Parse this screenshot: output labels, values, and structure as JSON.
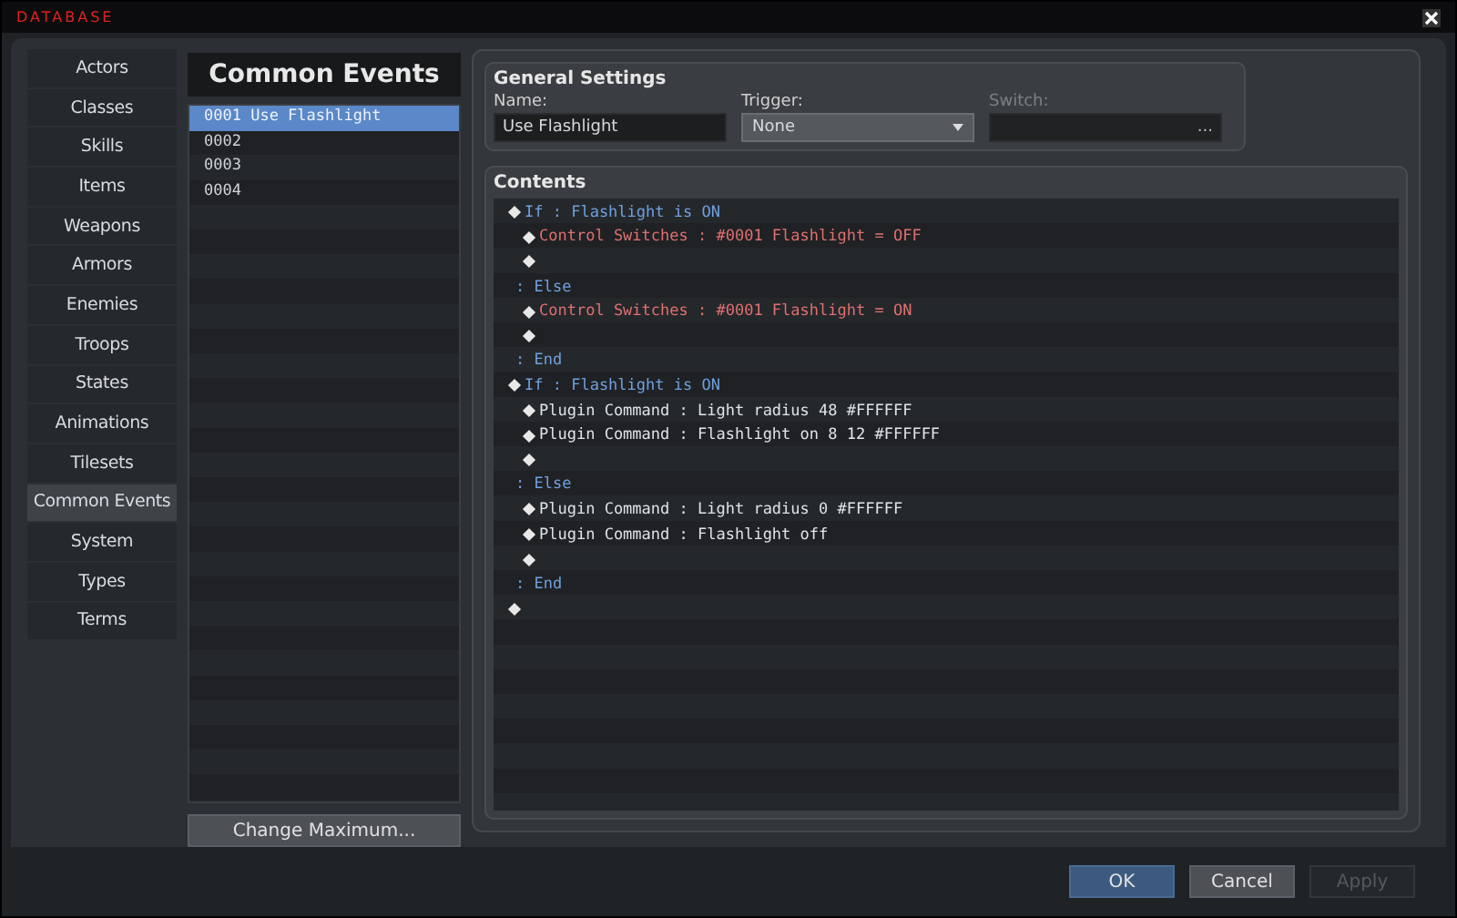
{
  "window": {
    "title": "DATABASE"
  },
  "sidebar": {
    "items": [
      {
        "label": "Actors",
        "selected": false
      },
      {
        "label": "Classes",
        "selected": false
      },
      {
        "label": "Skills",
        "selected": false
      },
      {
        "label": "Items",
        "selected": false
      },
      {
        "label": "Weapons",
        "selected": false
      },
      {
        "label": "Armors",
        "selected": false
      },
      {
        "label": "Enemies",
        "selected": false
      },
      {
        "label": "Troops",
        "selected": false
      },
      {
        "label": "States",
        "selected": false
      },
      {
        "label": "Animations",
        "selected": false
      },
      {
        "label": "Tilesets",
        "selected": false
      },
      {
        "label": "Common Events",
        "selected": true
      },
      {
        "label": "System",
        "selected": false
      },
      {
        "label": "Types",
        "selected": false
      },
      {
        "label": "Terms",
        "selected": false
      }
    ]
  },
  "event_list": {
    "title": "Common Events",
    "items": [
      {
        "label": "0001 Use Flashlight",
        "selected": true
      },
      {
        "label": "0002",
        "selected": false
      },
      {
        "label": "0003",
        "selected": false
      },
      {
        "label": "0004",
        "selected": false
      }
    ],
    "button": "Change Maximum..."
  },
  "general_settings": {
    "title": "General Settings",
    "name": {
      "label": "Name:",
      "value": "Use Flashlight"
    },
    "trigger": {
      "label": "Trigger:",
      "value": "None"
    },
    "switch": {
      "label": "Switch:",
      "disabled": true,
      "button": "..."
    }
  },
  "contents": {
    "title": "Contents",
    "lines": [
      {
        "kind": "if",
        "text": "If : Flashlight is ON",
        "children": [
          {
            "kind": "switch",
            "text": "Control Switches : #0001 Flashlight = OFF"
          },
          {
            "kind": "empty"
          }
        ]
      },
      {
        "kind": "else",
        "text": ": Else",
        "children": [
          {
            "kind": "switch",
            "text": "Control Switches : #0001 Flashlight = ON"
          },
          {
            "kind": "empty"
          }
        ]
      },
      {
        "kind": "end",
        "text": ": End"
      },
      {
        "kind": "if",
        "text": "If : Flashlight is ON",
        "children": [
          {
            "kind": "plugin",
            "text": "Plugin Command : Light radius 48 #FFFFFF"
          },
          {
            "kind": "plugin",
            "text": "Plugin Command : Flashlight on 8 12 #FFFFFF"
          },
          {
            "kind": "empty"
          }
        ]
      },
      {
        "kind": "else",
        "text": ": Else",
        "children": [
          {
            "kind": "plugin",
            "text": "Plugin Command : Light radius 0 #FFFFFF"
          },
          {
            "kind": "plugin",
            "text": "Plugin Command : Flashlight off"
          },
          {
            "kind": "empty"
          }
        ]
      },
      {
        "kind": "end",
        "text": ": End"
      },
      {
        "kind": "empty"
      }
    ]
  },
  "footer": {
    "buttons": [
      {
        "label": "OK",
        "kind": "primary",
        "disabled": false
      },
      {
        "label": "Cancel",
        "kind": "normal",
        "disabled": false
      },
      {
        "label": "Apply",
        "kind": "normal",
        "disabled": true
      }
    ]
  }
}
